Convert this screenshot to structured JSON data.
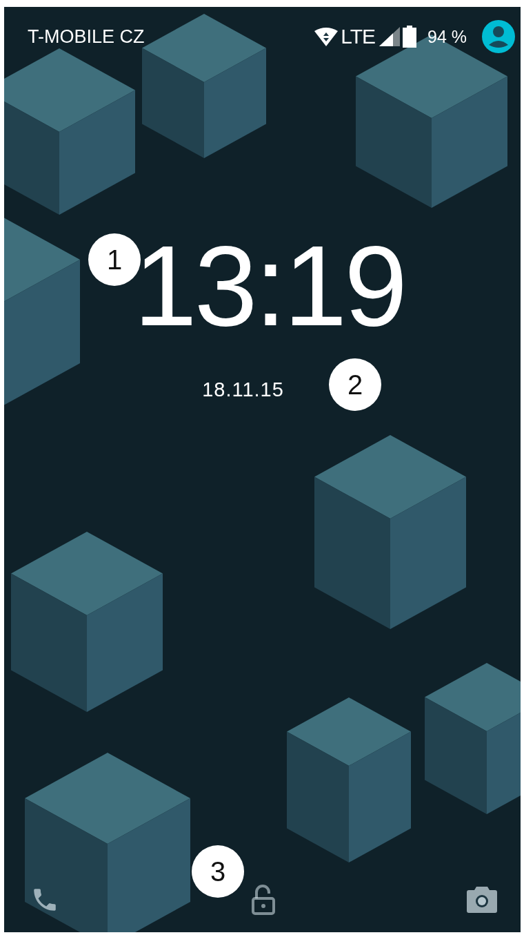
{
  "status_bar": {
    "carrier": "T-MOBILE CZ",
    "network": "LTE",
    "battery": "94 %"
  },
  "clock": {
    "time": "13:19",
    "callout": "1"
  },
  "date": {
    "text": "18.11.15",
    "callout": "2"
  },
  "unlock": {
    "callout": "3"
  }
}
